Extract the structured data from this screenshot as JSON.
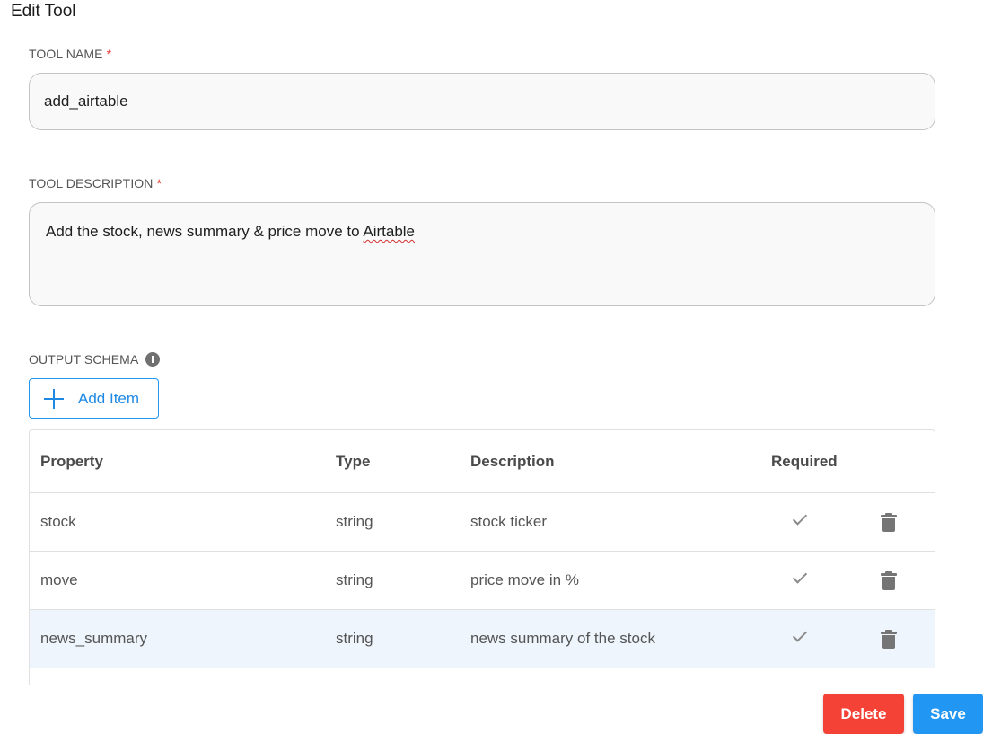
{
  "page": {
    "title": "Edit Tool"
  },
  "tool_name": {
    "label": "TOOL NAME",
    "required_mark": "*",
    "value": "add_airtable"
  },
  "tool_description": {
    "label": "TOOL DESCRIPTION",
    "required_mark": "*",
    "value_prefix": "Add the stock, news summary & price move to ",
    "value_spellchecked_word": "Airtable"
  },
  "output_schema": {
    "label": "OUTPUT SCHEMA",
    "info_icon": "info-icon",
    "add_item_label": "Add Item",
    "columns": {
      "property": "Property",
      "type": "Type",
      "description": "Description",
      "required": "Required"
    },
    "rows": [
      {
        "property": "stock",
        "type": "string",
        "description": "stock ticker",
        "required": true
      },
      {
        "property": "move",
        "type": "string",
        "description": "price move in %",
        "required": true
      },
      {
        "property": "news_summary",
        "type": "string",
        "description": "news summary of the stock",
        "required": true
      }
    ]
  },
  "actions": {
    "delete_label": "Delete",
    "save_label": "Save"
  },
  "colors": {
    "accent": "#2196f3",
    "danger": "#f44336",
    "required": "#e53935",
    "selected_row": "#eef5fd"
  }
}
